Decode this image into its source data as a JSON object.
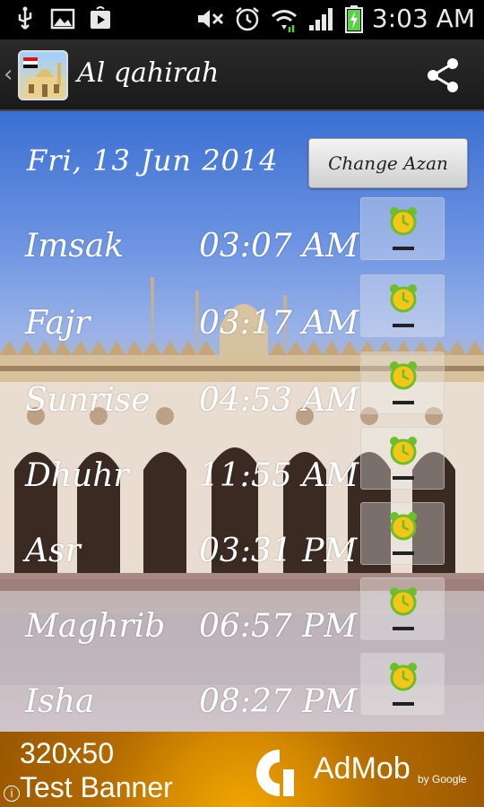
{
  "status_bar": {
    "time": "3:03 AM",
    "icons_left": [
      "usb-icon",
      "image-icon",
      "play-store-icon"
    ],
    "icons_right": [
      "mute-icon",
      "alarm-icon",
      "wifi-icon",
      "signal-icon",
      "battery-icon"
    ]
  },
  "action_bar": {
    "title": "Al qahirah",
    "share_icon": "share-icon"
  },
  "content": {
    "date": "Fri, 13 Jun 2014",
    "change_button": "Change Azan",
    "prayers": [
      {
        "name": "Imsak",
        "time": "03:07 AM"
      },
      {
        "name": "Fajr",
        "time": "03:17 AM"
      },
      {
        "name": "Sunrise",
        "time": "04:53 AM"
      },
      {
        "name": "Dhuhr",
        "time": "11:55 AM"
      },
      {
        "name": "Asr",
        "time": "03:31 PM"
      },
      {
        "name": "Maghrib",
        "time": "06:57 PM"
      },
      {
        "name": "Isha",
        "time": "08:27 PM"
      }
    ]
  },
  "ad": {
    "line1": "320x50",
    "line2": "Test Banner",
    "brand": "AdMob",
    "by": "by Google",
    "info": "i"
  },
  "colors": {
    "text": "#ffffff",
    "alarm_yellow": "#f5c518",
    "alarm_green": "#6cbf2a"
  }
}
